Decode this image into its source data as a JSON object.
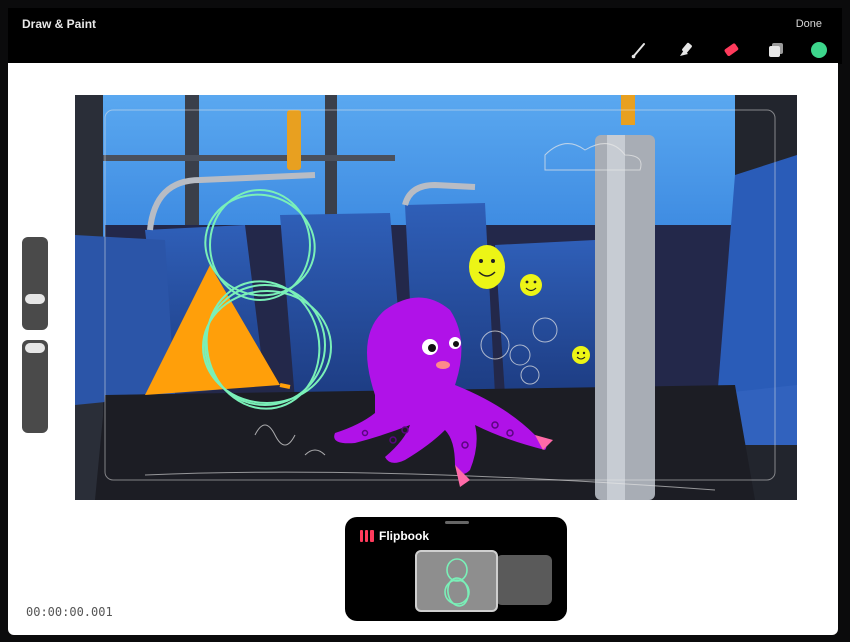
{
  "app": {
    "title": "Draw & Paint",
    "done_label": "Done"
  },
  "toolbar": {
    "tools": [
      {
        "name": "brush",
        "icon": "brush-icon"
      },
      {
        "name": "marker",
        "icon": "marker-icon"
      },
      {
        "name": "eraser",
        "icon": "eraser-icon",
        "color": "#ff3b5c"
      },
      {
        "name": "layers",
        "icon": "layers-icon"
      },
      {
        "name": "color",
        "icon": "color-swatch-icon",
        "color": "#3dd68c"
      }
    ]
  },
  "sliders": {
    "brush_size": {
      "level": 0.65
    },
    "opacity": {
      "level": 0.05
    }
  },
  "timecode": "00:00:00.001",
  "flipbook": {
    "title": "Flipbook",
    "icon": "flipbook-icon",
    "accent": "#ff3b5c"
  }
}
